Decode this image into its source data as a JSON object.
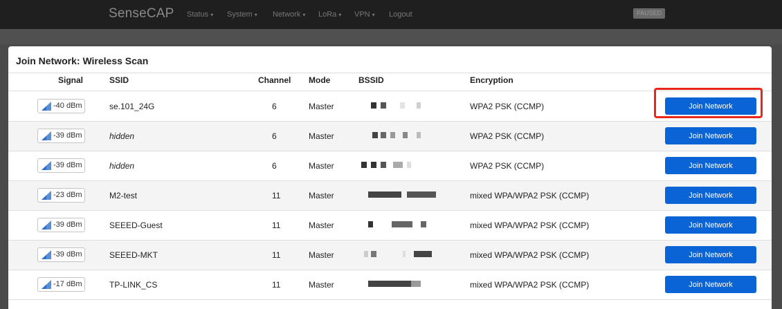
{
  "header": {
    "brand": "SenseCAP",
    "menu": [
      {
        "label": "Status",
        "caret": "▾"
      },
      {
        "label": "System",
        "caret": "▾"
      },
      {
        "label": "Network",
        "caret": "▾"
      },
      {
        "label": "LoRa",
        "caret": "▾"
      },
      {
        "label": "VPN",
        "caret": "▾"
      },
      {
        "label": "Logout",
        "caret": ""
      }
    ],
    "badge": "PAUSED"
  },
  "panel": {
    "title": "Join Network: Wireless Scan",
    "columns": {
      "signal": "Signal",
      "ssid": "SSID",
      "channel": "Channel",
      "mode": "Mode",
      "bssid": "BSSID",
      "encryption": "Encryption"
    },
    "rows": [
      {
        "signal": "-40 dBm",
        "ssid": "se.101_24G",
        "channel": "6",
        "mode": "Master",
        "encryption": "WPA2 PSK (CCMP)",
        "action": "Join Network",
        "hidden": false
      },
      {
        "signal": "-39 dBm",
        "ssid": "hidden",
        "channel": "6",
        "mode": "Master",
        "encryption": "WPA2 PSK (CCMP)",
        "action": "Join Network",
        "hidden": true
      },
      {
        "signal": "-39 dBm",
        "ssid": "hidden",
        "channel": "6",
        "mode": "Master",
        "encryption": "WPA2 PSK (CCMP)",
        "action": "Join Network",
        "hidden": true
      },
      {
        "signal": "-23 dBm",
        "ssid": "M2-test",
        "channel": "11",
        "mode": "Master",
        "encryption": "mixed WPA/WPA2 PSK (CCMP)",
        "action": "Join Network",
        "hidden": false
      },
      {
        "signal": "-39 dBm",
        "ssid": "SEEED-Guest",
        "channel": "11",
        "mode": "Master",
        "encryption": "mixed WPA/WPA2 PSK (CCMP)",
        "action": "Join Network",
        "hidden": false
      },
      {
        "signal": "-39 dBm",
        "ssid": "SEEED-MKT",
        "channel": "11",
        "mode": "Master",
        "encryption": "mixed WPA/WPA2 PSK (CCMP)",
        "action": "Join Network",
        "hidden": false
      },
      {
        "signal": "-17 dBm",
        "ssid": "TP-LINK_CS",
        "channel": "11",
        "mode": "Master",
        "encryption": "mixed WPA/WPA2 PSK (CCMP)",
        "action": "Join Network",
        "hidden": false
      }
    ]
  },
  "colors": {
    "join_button": "#0b64d6",
    "highlight": "#e8271b",
    "topbar": "#1f1f1f"
  },
  "icons": {
    "signal": "signal-strength-icon",
    "caret": "chevron-down-icon"
  }
}
